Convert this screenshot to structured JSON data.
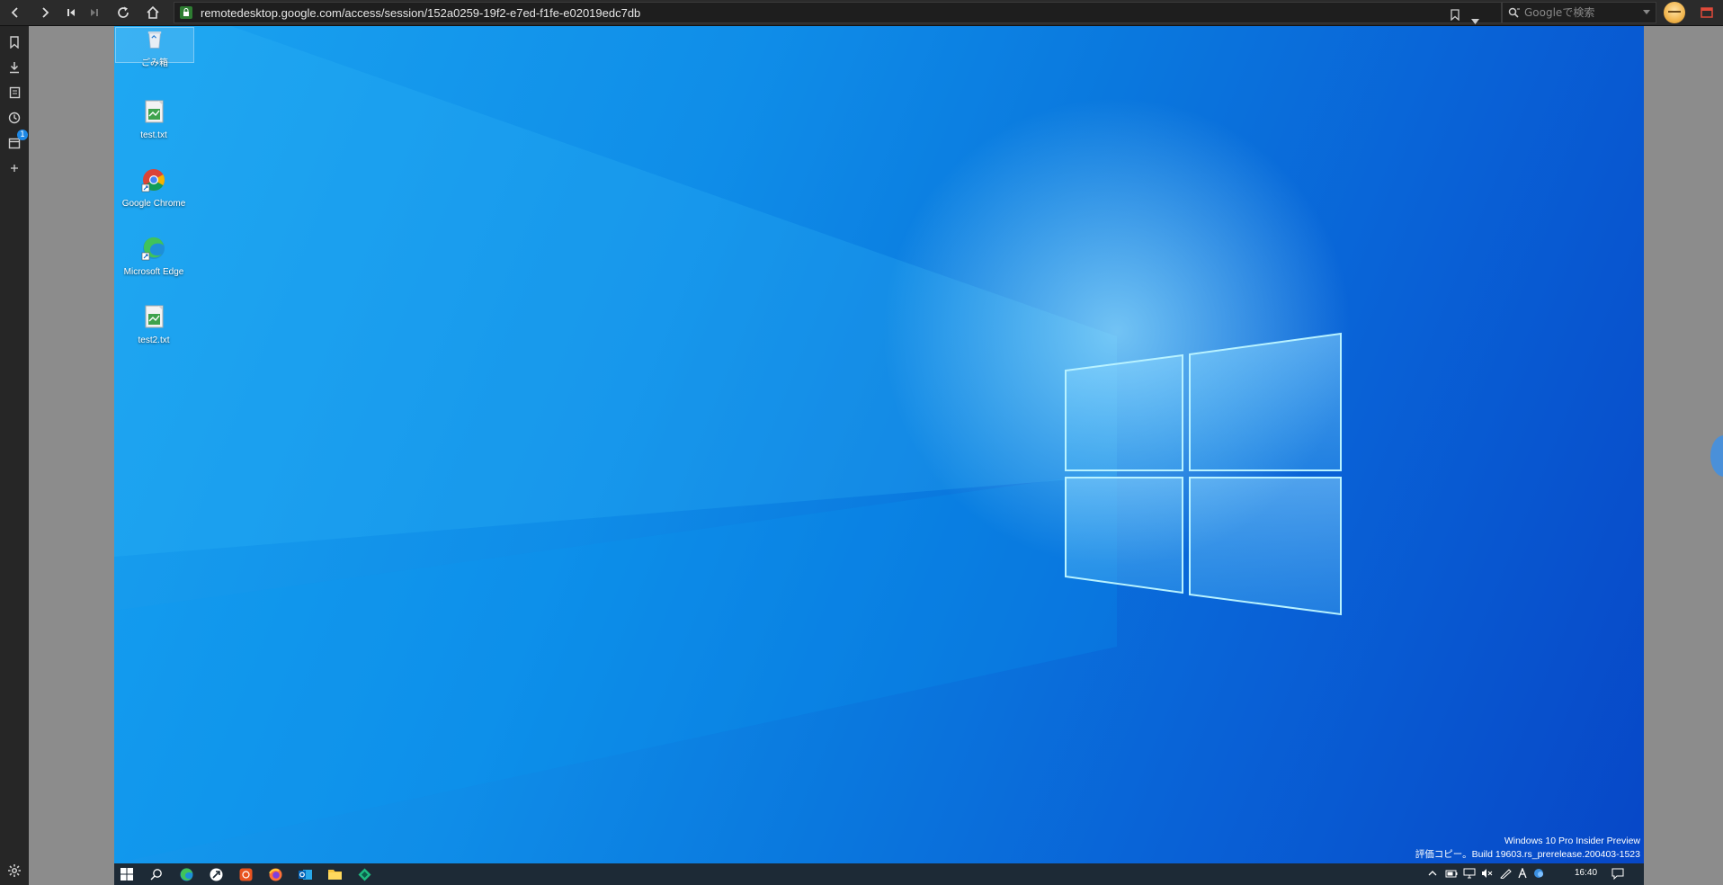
{
  "browser": {
    "url": "remotedesktop.google.com/access/session/152a0259-19f2-e7ed-f1fe-e02019edc7db",
    "search_placeholder": "Googleで検索"
  },
  "sidepanel": {
    "items": [
      {
        "icon": "bookmark-icon"
      },
      {
        "icon": "download-icon"
      },
      {
        "icon": "notes-icon"
      },
      {
        "icon": "history-icon"
      },
      {
        "icon": "windows-icon",
        "badge": "1"
      },
      {
        "icon": "add-panel-icon"
      }
    ]
  },
  "desktop": {
    "icons": [
      {
        "label": "ごみ箱",
        "icon": "recycle-bin-icon"
      },
      {
        "label": "test.txt",
        "icon": "text-file-icon"
      },
      {
        "label": "Google Chrome",
        "icon": "chrome-icon"
      },
      {
        "label": "Microsoft Edge",
        "icon": "edge-icon"
      },
      {
        "label": "test2.txt",
        "icon": "text-file-icon"
      }
    ],
    "watermark_line1": "Windows 10 Pro Insider Preview",
    "watermark_line2": "評価コピー。Build 19603.rs_prerelease.200403-1523"
  },
  "taskbar": {
    "apps": [
      "start-icon",
      "search-icon",
      "edge-icon",
      "app-icon",
      "ubuntu-icon",
      "firefox-icon",
      "outlook-icon",
      "file-explorer-icon",
      "chrome-remote-icon"
    ],
    "tray": [
      "chevron-up-icon",
      "battery-icon",
      "network-icon",
      "volume-muted-icon",
      "pen-icon",
      "ime-icon",
      "cloud-icon"
    ],
    "time": "16:40"
  }
}
